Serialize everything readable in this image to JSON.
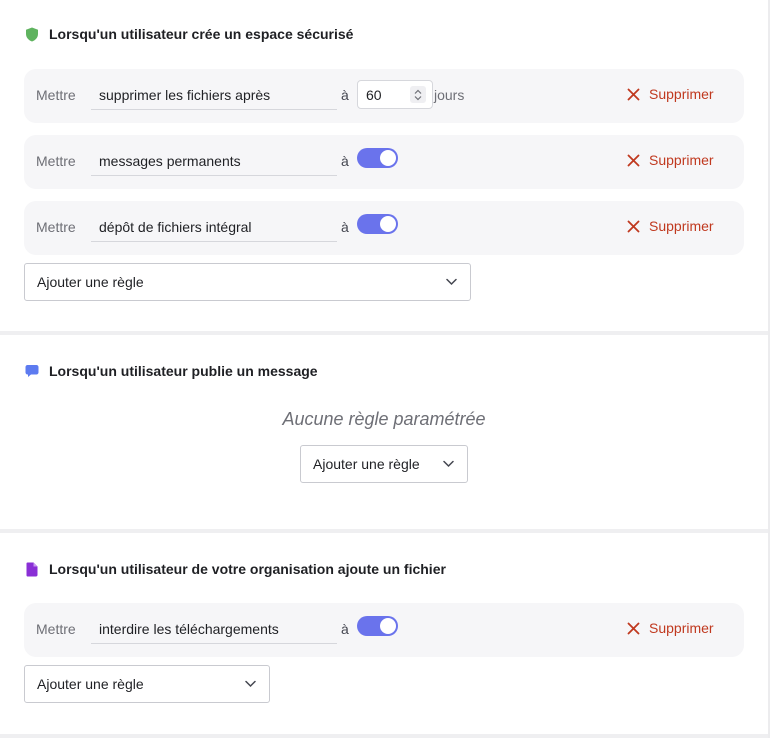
{
  "sections": [
    {
      "title": "Lorsqu'un utilisateur crée un espace sécurisé",
      "icon": "shield-icon",
      "icon_color": "#5fb35f",
      "rules": [
        {
          "put_label": "Mettre",
          "field": "supprimer les fichiers après",
          "to_label": "à",
          "value": "60",
          "unit": "jours",
          "delete_label": "Supprimer"
        },
        {
          "put_label": "Mettre",
          "field": "messages permanents",
          "to_label": "à",
          "toggle": true,
          "delete_label": "Supprimer"
        },
        {
          "put_label": "Mettre",
          "field": "dépôt de fichiers intégral",
          "to_label": "à",
          "toggle": true,
          "delete_label": "Supprimer"
        }
      ],
      "add_rule": "Ajouter une règle"
    },
    {
      "title": "Lorsqu'un utilisateur publie un message",
      "icon": "chat-bubble-icon",
      "icon_color": "#5d7bf0",
      "empty_text": "Aucune règle paramétrée",
      "add_rule": "Ajouter une règle"
    },
    {
      "title": "Lorsqu'un utilisateur de votre organisation ajoute un fichier",
      "icon": "file-icon",
      "icon_color": "#8a2fd6",
      "rules": [
        {
          "put_label": "Mettre",
          "field": "interdire les téléchargements",
          "to_label": "à",
          "toggle": true,
          "delete_label": "Supprimer"
        }
      ],
      "add_rule": "Ajouter une règle"
    }
  ],
  "colors": {
    "accent_toggle": "#6a73ec",
    "delete_red": "#c0391f",
    "row_bg": "#f6f6f8"
  }
}
